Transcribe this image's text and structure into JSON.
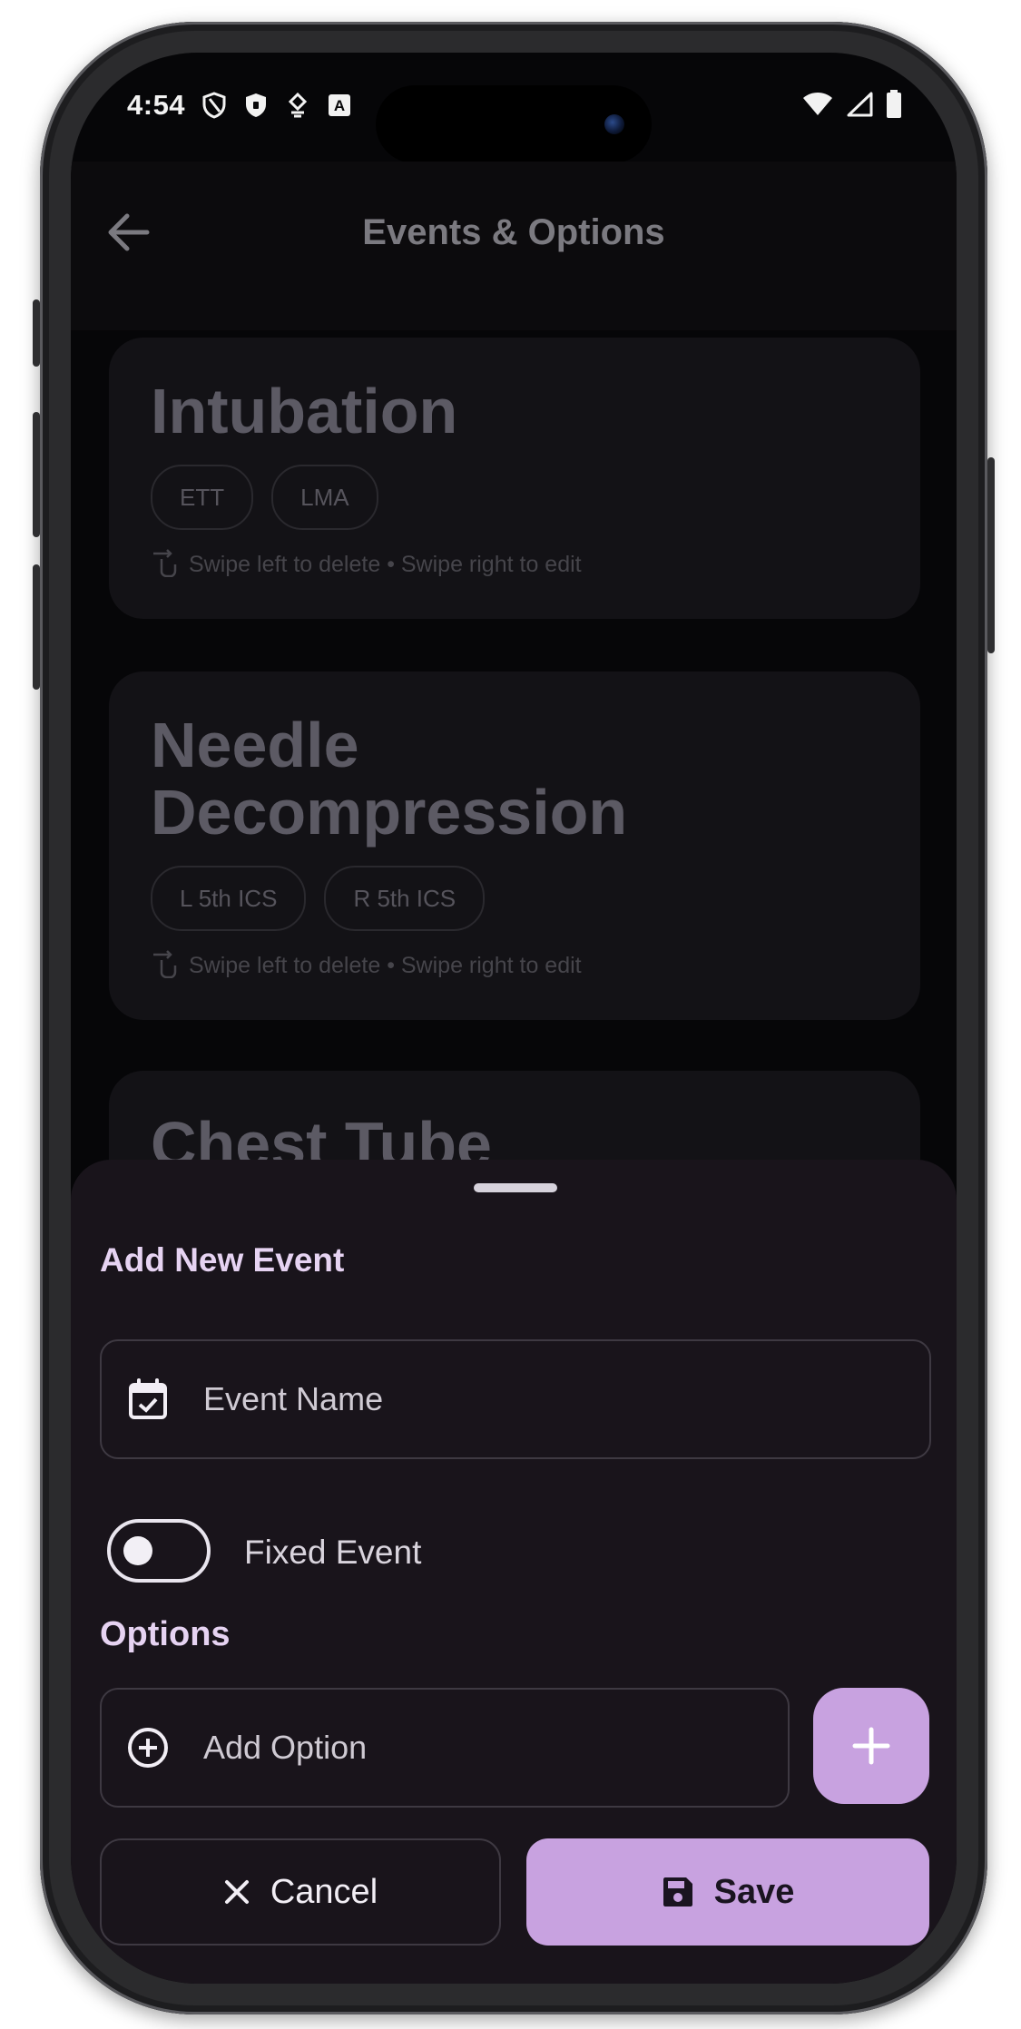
{
  "status_bar": {
    "time": "4:54",
    "left_icons": [
      "shield-outline-icon",
      "shield-filled-icon",
      "vpn-key-icon",
      "a-box-icon"
    ],
    "right_icons": [
      "wifi-icon",
      "cellular-icon",
      "battery-icon"
    ]
  },
  "app_bar": {
    "title": "Events & Options",
    "back_icon": "arrow-left-icon"
  },
  "events": [
    {
      "title": "Intubation",
      "options": [
        "ETT",
        "LMA"
      ],
      "hint": "Swipe left to delete • Swipe right to edit"
    },
    {
      "title_lines": [
        "Needle",
        "Decompression"
      ],
      "options": [
        "L 5th ICS",
        "R 5th ICS"
      ],
      "hint": "Swipe left to delete • Swipe right to edit"
    },
    {
      "title": "Chest Tube"
    }
  ],
  "sheet": {
    "title": "Add New Event",
    "event_name_placeholder": "Event Name",
    "fixed_event_label": "Fixed Event",
    "fixed_event_on": false,
    "options_title": "Options",
    "add_option_placeholder": "Add Option",
    "cancel_label": "Cancel",
    "save_label": "Save"
  },
  "colors": {
    "accent": "#c8a2e0",
    "sheet_bg": "#19141b",
    "screen_bg": "#060608",
    "heading": "#e6d3f2"
  }
}
